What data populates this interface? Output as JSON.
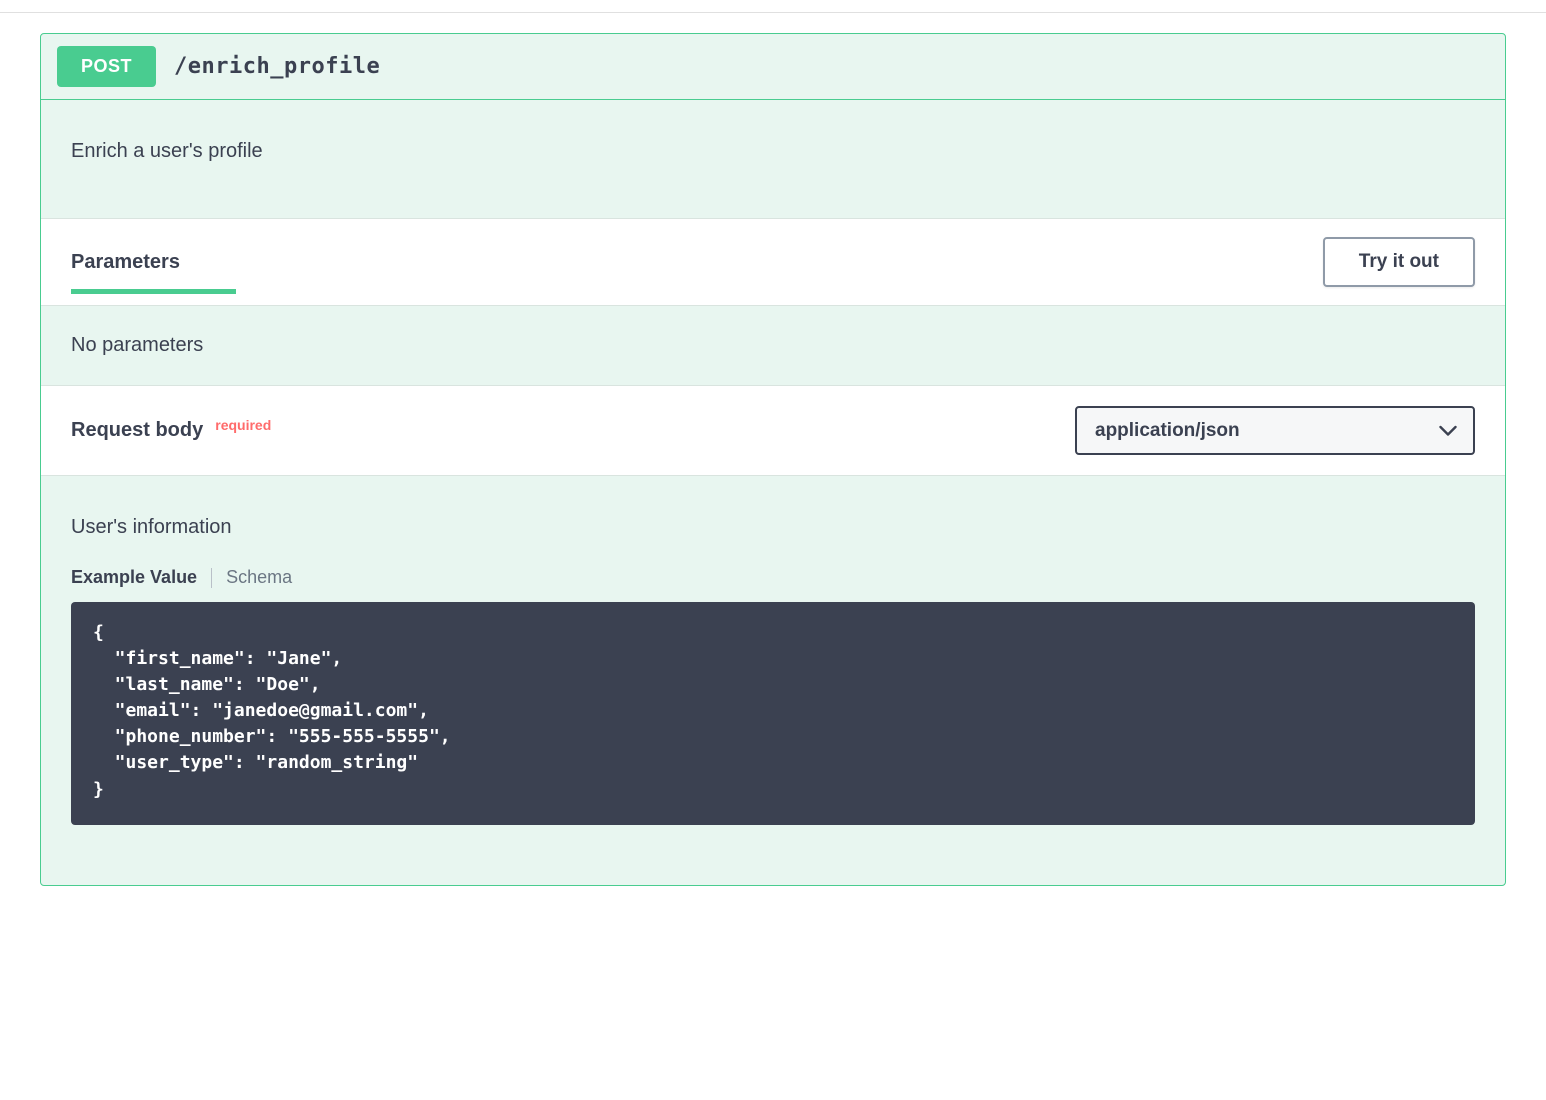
{
  "operation": {
    "method": "POST",
    "path": "/enrich_profile",
    "description": "Enrich a user's profile"
  },
  "parameters": {
    "section_title": "Parameters",
    "try_button_label": "Try it out",
    "empty_message": "No parameters"
  },
  "request_body": {
    "section_title": "Request body",
    "required_tag": "required",
    "content_type": "application/json",
    "description": "User's information",
    "tab_example_label": "Example Value",
    "tab_schema_label": "Schema",
    "example": "{\n  \"first_name\": \"Jane\",\n  \"last_name\": \"Doe\",\n  \"email\": \"janedoe@gmail.com\",\n  \"phone_number\": \"555-555-5555\",\n  \"user_type\": \"random_string\"\n}"
  }
}
